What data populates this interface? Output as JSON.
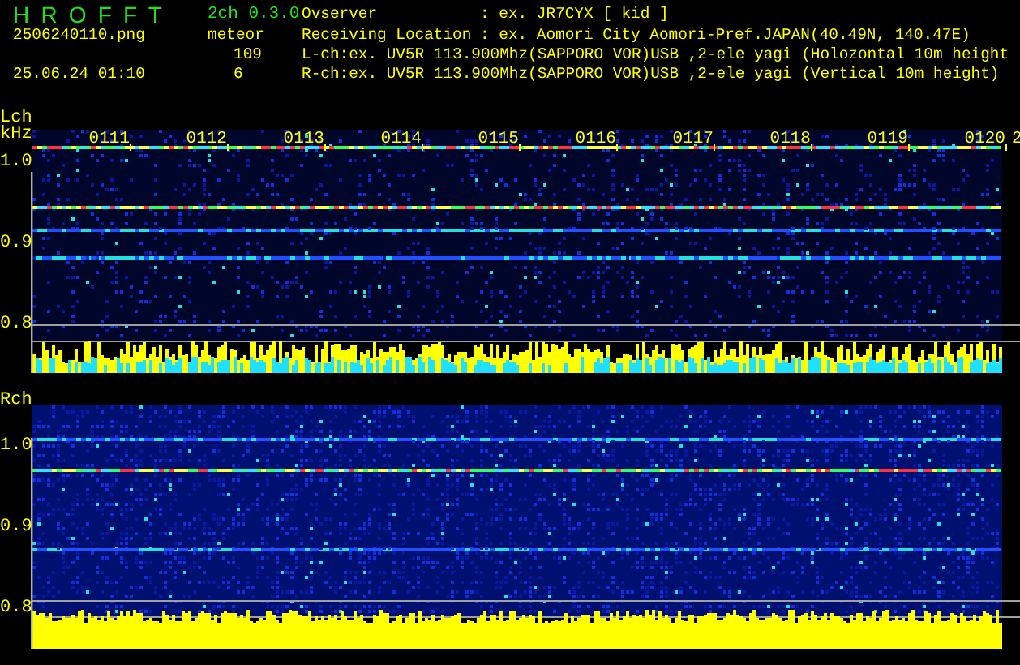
{
  "header": {
    "app_name": "H R O F F T",
    "version": "2ch 0.3.0",
    "file_name": "2506240110.png",
    "date_time": "25.06.24 01:10",
    "meteor_label": "meteor",
    "meteor_counts": [
      "109",
      "6"
    ]
  },
  "info": [
    {
      "label": "Ovserver",
      "separator": ":",
      "value": "ex. JR7CYX [ kid ]"
    },
    {
      "label": "Receiving Location",
      "separator": ":",
      "value": "ex. Aomori City Aomori-Pref.JAPAN(40.49N, 140.47E)"
    }
  ],
  "channel_lines": [
    "L-ch:ex. UV5R 113.900Mhz(SAPPORO VOR)USB ,2-ele yagi (Holozontal 10m height",
    "R-ch:ex. UV5R 113.900Mhz(SAPPORO VOR)USB ,2-ele yagi (Vertical 10m height)"
  ],
  "panels": [
    {
      "label": "Lch",
      "unit": "kHz",
      "time_ticks": [
        "0111",
        "0112",
        "0113",
        "0114",
        "0115",
        "0116",
        "0117",
        "0118",
        "0119",
        "0120",
        "2"
      ],
      "freq_labels": [
        "1.0",
        "0.9",
        "0.8"
      ]
    },
    {
      "label": "Rch",
      "freq_labels": [
        "1.0",
        "0.9",
        "0.8"
      ]
    }
  ]
}
